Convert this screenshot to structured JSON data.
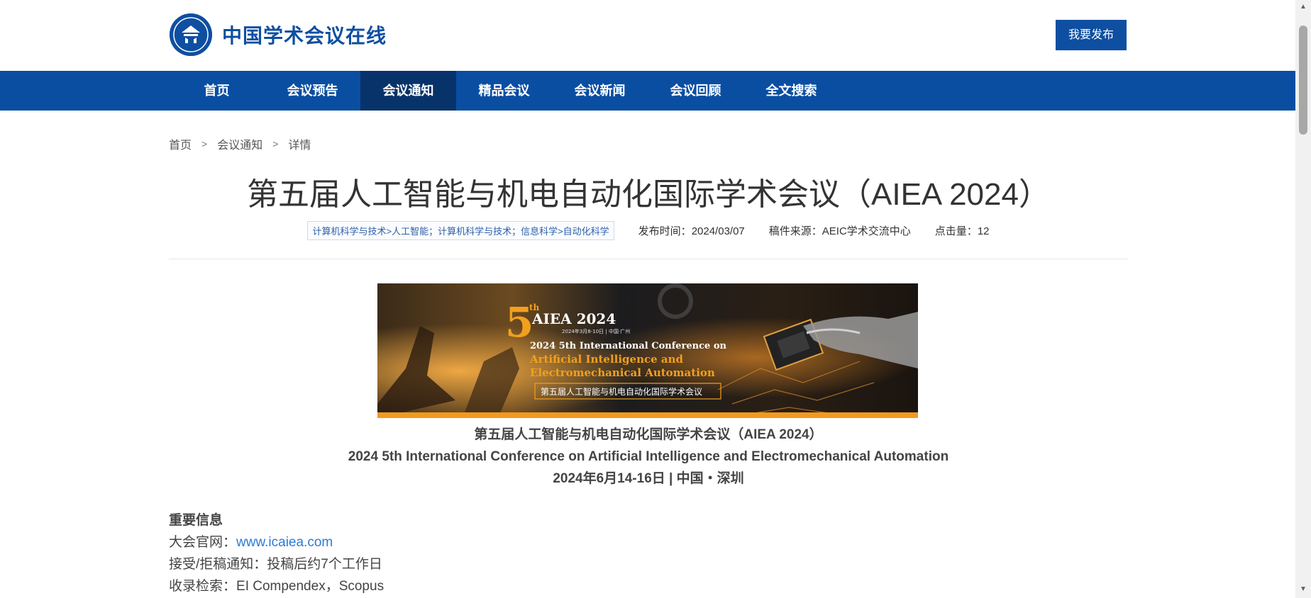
{
  "site": {
    "logo_text": "中国学术会议在线",
    "publish_label": "我要发布"
  },
  "nav": {
    "items": [
      {
        "label": "首页"
      },
      {
        "label": "会议预告"
      },
      {
        "label": "会议通知"
      },
      {
        "label": "精品会议"
      },
      {
        "label": "会议新闻"
      },
      {
        "label": "会议回顾"
      },
      {
        "label": "全文搜索"
      }
    ],
    "active_index": 2
  },
  "breadcrumb": {
    "items": [
      "首页",
      "会议通知",
      "详情"
    ],
    "separator": ">"
  },
  "article": {
    "title": "第五届人工智能与机电自动化国际学术会议（AIEA 2024）",
    "tag": "计算机科学与技术>人工智能；计算机科学与技术；信息科学>自动化科学",
    "publish_time_label": "发布时间：",
    "publish_time": "2024/03/07",
    "source_label": "稿件来源：",
    "source": "AEIC学术交流中心",
    "clicks_label": "点击量：",
    "clicks": "12"
  },
  "banner": {
    "number": "5",
    "number_suffix": "th",
    "acronym": "AIEA 2024",
    "date_line": "2024年3月8-10日 | 中国·广州",
    "conf_line1": "2024 5th International Conference on",
    "conf_line2": "Artificial Intelligence and",
    "conf_line3": "Electromechanical Automation",
    "cn_name": "第五届人工智能与机电自动化国际学术会议"
  },
  "conference": {
    "cn_title": "第五届人工智能与机电自动化国际学术会议（AIEA 2024）",
    "en_title": "2024 5th International Conference on Artificial Intelligence and Electromechanical Automation",
    "date_place": "2024年6月14-16日 | 中国・深圳"
  },
  "important_info": {
    "heading": "重要信息",
    "website_label": "大会官网：",
    "website": "www.icaiea.com",
    "notice_label": "接受/拒稿通知：",
    "notice": "投稿后约7个工作日",
    "index_label": "收录检索：",
    "index": "EI Compendex，Scopus"
  },
  "colors": {
    "brand_blue": "#0a4ea2",
    "nav_active": "#08336a",
    "accent_orange": "#f09a1e",
    "link_blue": "#2b7bd6"
  }
}
